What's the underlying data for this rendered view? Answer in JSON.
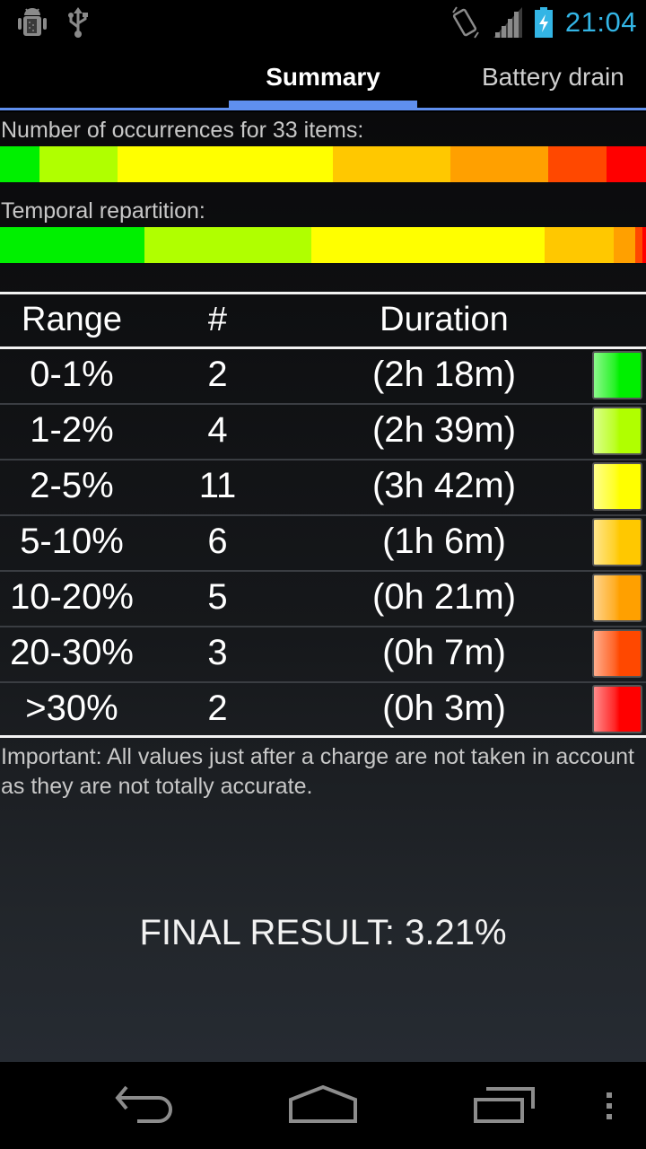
{
  "status_bar": {
    "time": "21:04",
    "left_icons": [
      "android-debug-icon",
      "usb-icon"
    ],
    "right_icons": [
      "vibrate-icon",
      "signal-icon",
      "battery-charging-icon"
    ],
    "time_color": "#33b5e5"
  },
  "tabs": [
    {
      "label": "Summary",
      "selected": true
    },
    {
      "label": "Battery drain",
      "selected": false
    }
  ],
  "tab_indicator_color": "#5f8fee",
  "occurrences": {
    "label": "Number of occurrences for 33 items:",
    "total_items": 33
  },
  "temporal": {
    "label": "Temporal repartition:"
  },
  "table": {
    "headers": {
      "range": "Range",
      "count": "#",
      "duration": "Duration"
    },
    "rows": [
      {
        "range": "0-1%",
        "count": "2",
        "duration": "(2h 18m)",
        "minutes": 138,
        "color": "#00f000"
      },
      {
        "range": "1-2%",
        "count": "4",
        "duration": "(2h 39m)",
        "minutes": 159,
        "color": "#b0ff00"
      },
      {
        "range": "2-5%",
        "count": "11",
        "duration": "(3h 42m)",
        "minutes": 222,
        "color": "#ffff00"
      },
      {
        "range": "5-10%",
        "count": "6",
        "duration": "(1h 6m)",
        "minutes": 66,
        "color": "#ffc800"
      },
      {
        "range": "10-20%",
        "count": "5",
        "duration": "(0h 21m)",
        "minutes": 21,
        "color": "#ffa000"
      },
      {
        "range": "20-30%",
        "count": "3",
        "duration": "(0h 7m)",
        "minutes": 7,
        "color": "#ff4800"
      },
      {
        "range": ">30%",
        "count": "2",
        "duration": "(0h 3m)",
        "minutes": 3,
        "color": "#ff0000"
      }
    ]
  },
  "note": "Important: All values just after a charge are not taken in account as they are not totally accurate.",
  "final_result": "FINAL RESULT: 3.21%",
  "nav_bar": {
    "buttons": [
      "back-icon",
      "home-icon",
      "recent-apps-icon",
      "overflow-menu-icon"
    ]
  }
}
